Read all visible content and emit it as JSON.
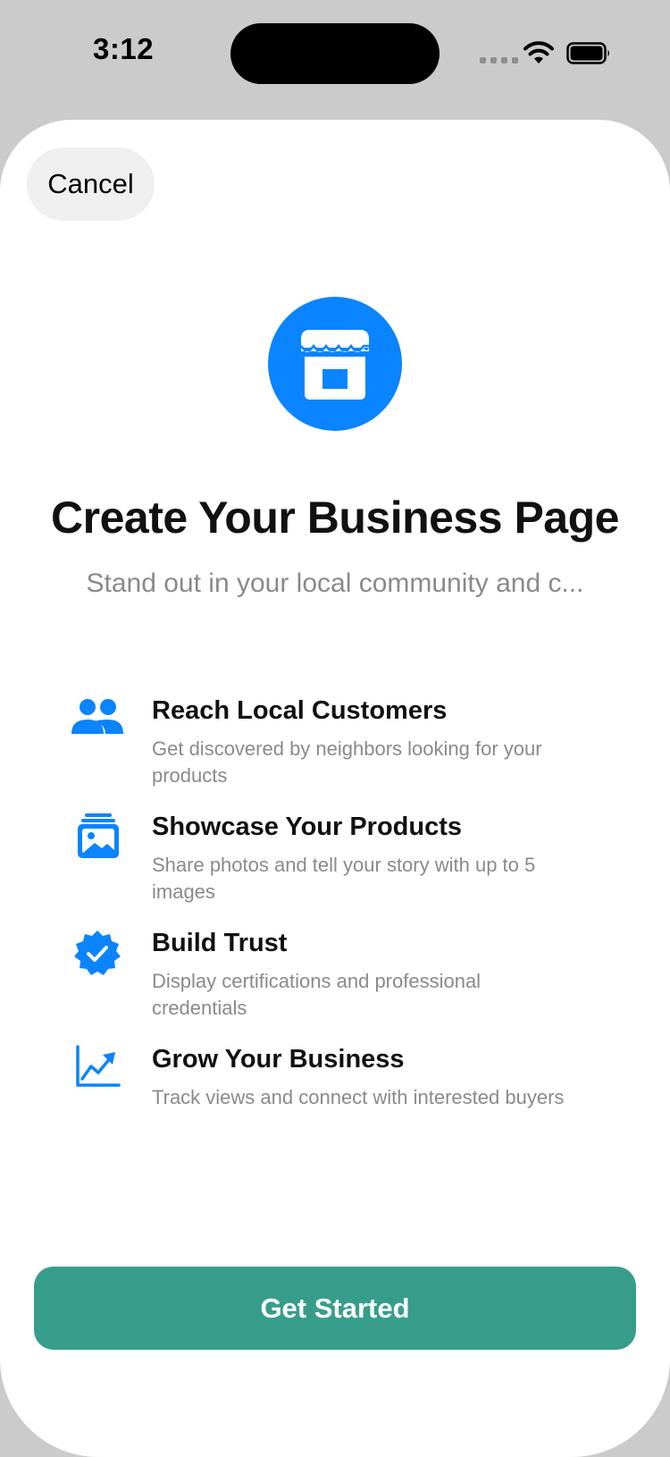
{
  "status_bar": {
    "time": "3:12"
  },
  "sheet": {
    "cancel_label": "Cancel",
    "hero_icon": "storefront-icon",
    "accent_color": "#0a84ff",
    "title": "Create Your Business Page",
    "subtitle": "Stand out in your local community and c..."
  },
  "features": [
    {
      "icon": "people-icon",
      "title": "Reach Local Customers",
      "description": "Get discovered by neighbors looking for your products"
    },
    {
      "icon": "photo-stack-icon",
      "title": "Showcase Your Products",
      "description": "Share photos and tell your story with up to 5 images"
    },
    {
      "icon": "verified-badge-icon",
      "title": "Build Trust",
      "description": "Display certifications and professional credentials"
    },
    {
      "icon": "trending-chart-icon",
      "title": "Grow Your Business",
      "description": "Track views and connect with interested buyers"
    }
  ],
  "footer": {
    "button_label": "Get Started",
    "button_color": "#379d8b"
  }
}
